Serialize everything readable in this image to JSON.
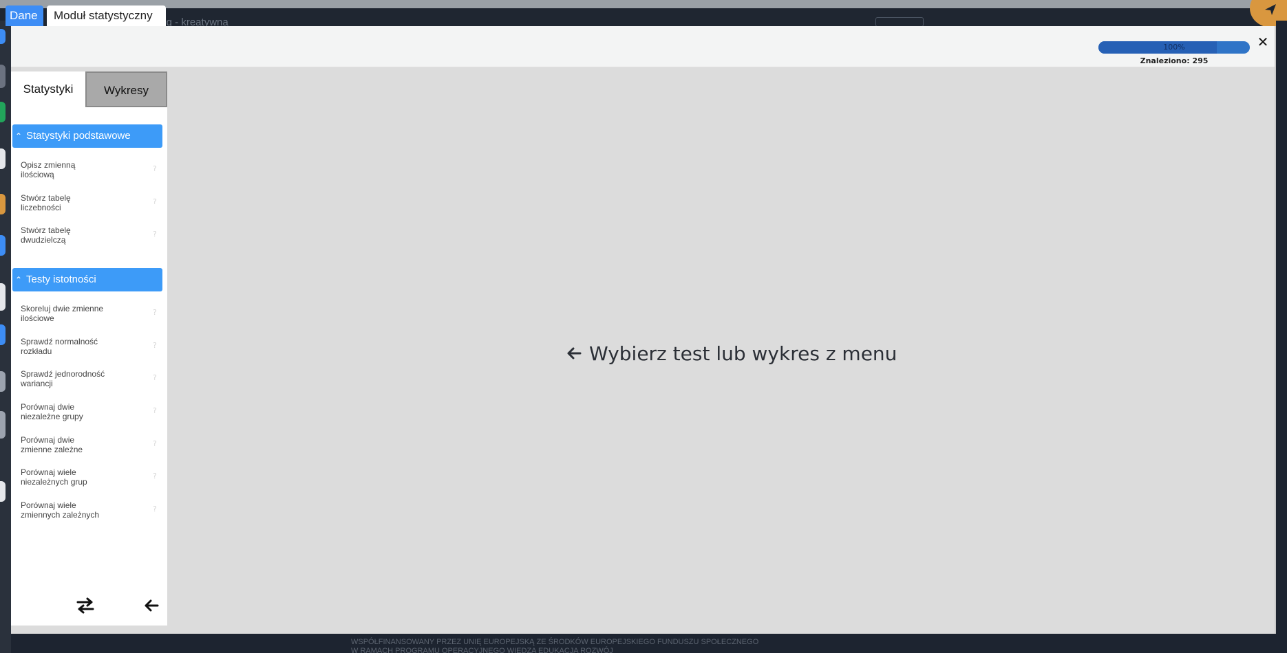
{
  "background": {
    "header_text": "ing - kreatywna",
    "footer_lines": "WSPÓŁFINANSOWANY PRZEZ UNIĘ EUROPEJSKĄ ZE ŚRODKÓW EUROPEJSKIEGO FUNDUSZU SPOŁECZNEGO\nW RAMACH PROGRAMU OPERACYJNEGO WIEDZA EDUKACJA ROZWÓJ"
  },
  "tabs": {
    "dane": "Dane",
    "modul": "Moduł statystyczny"
  },
  "progress": {
    "label": "100%",
    "percent": 100,
    "found": "Znaleziono: 295"
  },
  "close_label": "✕",
  "sidebar": {
    "tabs": {
      "stats": "Statystyki",
      "charts": "Wykresy"
    },
    "sections": [
      {
        "title": "Statystyki podstawowe",
        "items": [
          {
            "l1": "Opisz zmienną",
            "l2": "ilościową"
          },
          {
            "l1": "Stwórz tabelę",
            "l2": "liczebności"
          },
          {
            "l1": "Stwórz tabelę",
            "l2": "dwudzielczą"
          }
        ]
      },
      {
        "title": "Testy istotności",
        "items": [
          {
            "l1": "Skoreluj dwie zmienne",
            "l2": "ilościowe"
          },
          {
            "l1": "Sprawdź normalność",
            "l2": "rozkładu"
          },
          {
            "l1": "Sprawdź jednorodność",
            "l2": "wariancji"
          },
          {
            "l1": "Porównaj dwie",
            "l2": "niezależne grupy"
          },
          {
            "l1": "Porównaj dwie",
            "l2": "zmienne zależne"
          },
          {
            "l1": "Porównaj wiele",
            "l2": "niezależnych grup"
          },
          {
            "l1": "Porównaj wiele",
            "l2": "zmiennych zależnych"
          }
        ]
      }
    ],
    "help_glyph": "?"
  },
  "main": {
    "message": "Wybierz test lub wykres z menu"
  },
  "icons": {
    "send": "send-icon",
    "swap": "swap-arrows-icon",
    "back": "arrow-left-icon"
  },
  "colors": {
    "accent": "#3d9bf8",
    "tab_active": "#3d8df5",
    "progress": "#2f74c7"
  }
}
